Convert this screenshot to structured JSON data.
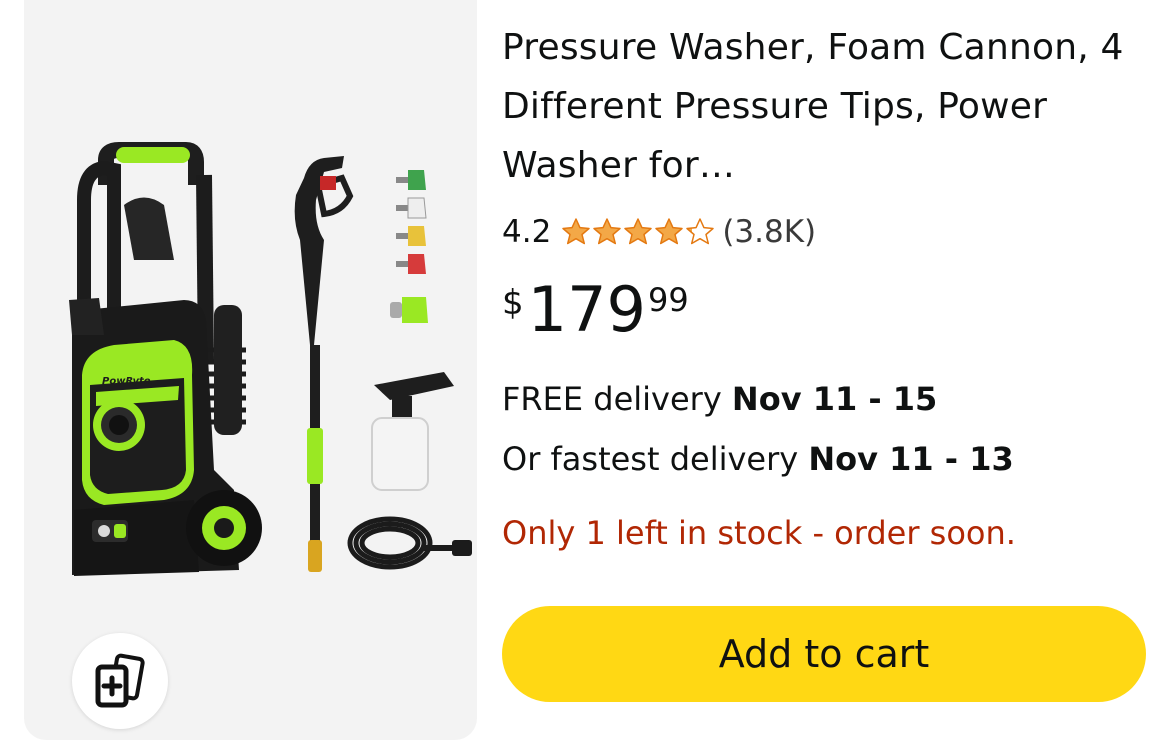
{
  "product": {
    "title": "Pressure Washer, Foam Cannon, 4 Different Pressure Tips, Power Washer for…",
    "image_brand_text": "PowRyte",
    "rating_value": "4.2",
    "rating_stars": 4.2,
    "review_count": "(3.8K)",
    "price": {
      "symbol": "$",
      "whole": "179",
      "fraction": "99"
    }
  },
  "delivery": {
    "free_prefix": "FREE delivery ",
    "free_dates": "Nov 11 - 15",
    "fast_prefix": "Or fastest delivery ",
    "fast_dates": "Nov 11 - 13"
  },
  "stock_message": "Only 1 left in stock - order soon.",
  "actions": {
    "add_to_cart": "Add to cart"
  },
  "icons": {
    "compare": "add-to-compare-icon",
    "star": "star-icon"
  },
  "colors": {
    "star": "#f3a847",
    "stock": "#b12704",
    "cart_button": "#ffd814",
    "product_green": "#9ae823"
  }
}
